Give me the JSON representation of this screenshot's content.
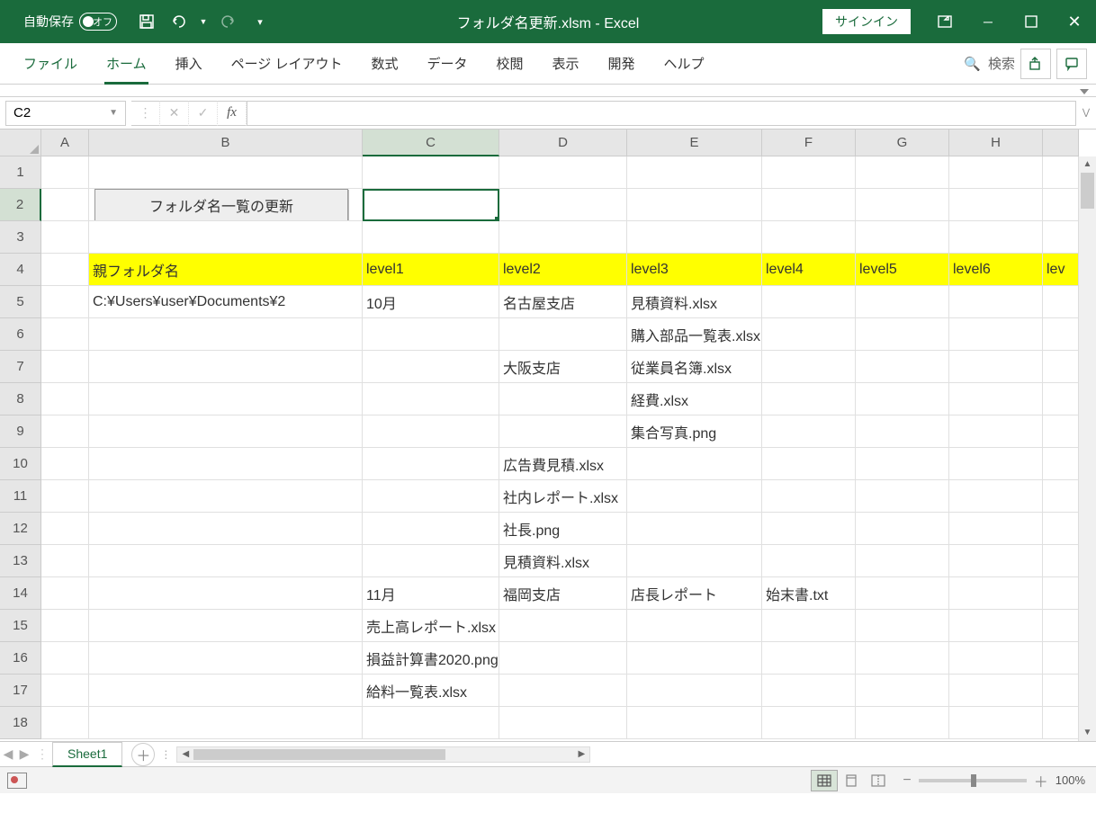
{
  "title": {
    "autosave": "自動保存",
    "autosave_state": "オフ",
    "filename": "フォルダ名更新.xlsm  -  Excel",
    "signin": "サインイン"
  },
  "ribbon": {
    "file": "ファイル",
    "home": "ホーム",
    "insert": "挿入",
    "layout": "ページ レイアウト",
    "formulas": "数式",
    "data": "データ",
    "review": "校閲",
    "view": "表示",
    "developer": "開発",
    "help": "ヘルプ",
    "search": "検索"
  },
  "fbar": {
    "namebox": "C2"
  },
  "cols": [
    "A",
    "B",
    "C",
    "D",
    "E",
    "F",
    "G",
    "H"
  ],
  "headers": {
    "B": "親フォルダ名",
    "C": "level1",
    "D": "level2",
    "E": "level3",
    "F": "level4",
    "G": "level5",
    "H": "level6",
    "I": "lev"
  },
  "macroButton": "フォルダ名一覧の更新",
  "grid": {
    "5": {
      "B": "C:¥Users¥user¥Documents¥2",
      "C": "10月",
      "D": "名古屋支店",
      "E": "見積資料.xlsx"
    },
    "6": {
      "E": "購入部品一覧表.xlsx"
    },
    "7": {
      "D": "大阪支店",
      "E": "従業員名簿.xlsx"
    },
    "8": {
      "E": "経費.xlsx"
    },
    "9": {
      "E": "集合写真.png"
    },
    "10": {
      "D": "広告費見積.xlsx"
    },
    "11": {
      "D": "社内レポート.xlsx"
    },
    "12": {
      "D": "社長.png"
    },
    "13": {
      "D": "見積資料.xlsx"
    },
    "14": {
      "C": "11月",
      "D": "福岡支店",
      "E": "店長レポート",
      "F": "始末書.txt"
    },
    "15": {
      "C": "売上高レポート.xlsx"
    },
    "16": {
      "C": "損益計算書2020.png"
    },
    "17": {
      "C": "給料一覧表.xlsx"
    }
  },
  "sheet": {
    "active": "Sheet1"
  },
  "status": {
    "zoom": "100%"
  }
}
